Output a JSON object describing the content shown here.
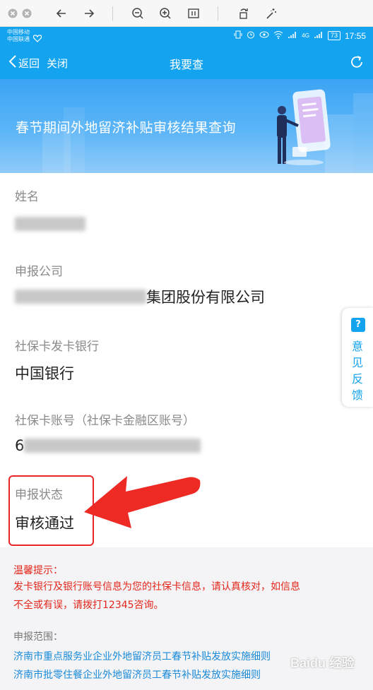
{
  "status_bar": {
    "carrier1": "中国移动",
    "carrier2": "中国联通",
    "network": "4G",
    "battery": "73",
    "time": "17:55"
  },
  "nav": {
    "back_label": "返回",
    "close_label": "关闭",
    "title": "我要查"
  },
  "banner": {
    "title": "春节期间外地留济补贴审核结果查询"
  },
  "fields": {
    "name_label": "姓名",
    "company_label": "申报公司",
    "company_value_suffix": "集团股份有限公司",
    "bank_label": "社保卡发卡银行",
    "bank_value": "中国银行",
    "account_label": "社保卡账号（社保卡金融区账号）",
    "account_value_prefix": "6",
    "status_label": "申报状态",
    "status_value": "审核通过"
  },
  "feedback": {
    "icon": "?",
    "label": "意见反馈"
  },
  "tips": {
    "heading": "温馨提示：",
    "line1": "发卡银行及银行账号信息为您的社保卡信息，请认真核对，如信息",
    "line2": "不全或有误，请拨打12345咨询。",
    "scope_heading": "申报范围：",
    "link1": "济南市重点服务业企业外地留济员工春节补贴发放实施细则",
    "link2": "济南市批零住餐企业外地留济员工春节补贴发放实施细则"
  },
  "watermark": "Baidu 经验",
  "colors": {
    "brand_blue": "#14a3ee",
    "alert_red": "#e3261b",
    "highlight_red": "#e8262a",
    "link_blue": "#1a8ad8"
  }
}
